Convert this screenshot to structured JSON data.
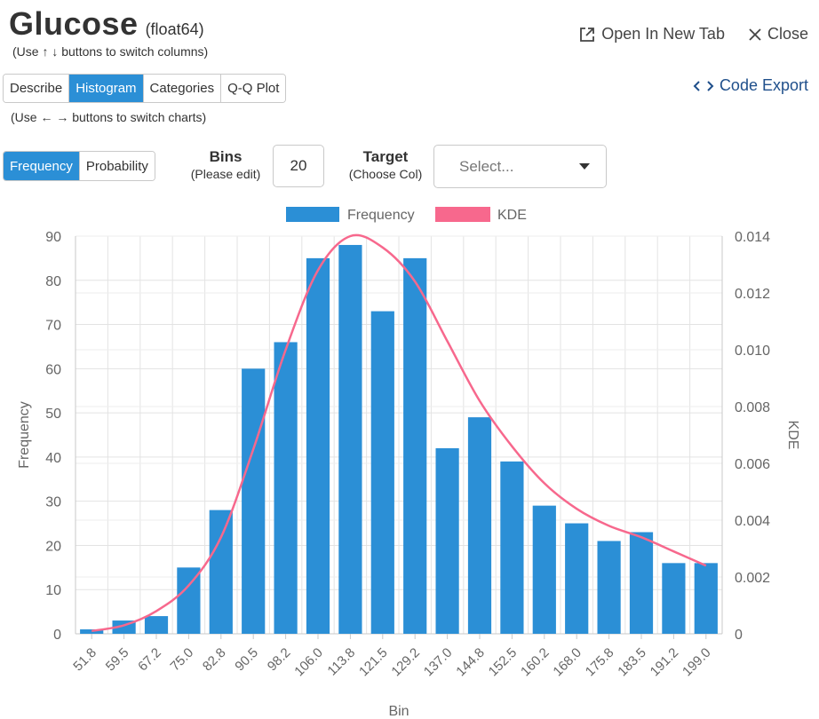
{
  "header": {
    "title": "Glucose",
    "dtype": "(float64)",
    "hint_columns": "(Use ↑ ↓ buttons to switch columns)",
    "hint_charts": "(Use ← → buttons to switch charts)",
    "open_new_tab": "Open In New Tab",
    "close": "Close",
    "code_export": "Code Export"
  },
  "chart_tabs": [
    "Describe",
    "Histogram",
    "Categories",
    "Q-Q Plot"
  ],
  "chart_tabs_active": "Histogram",
  "mode_tabs": [
    "Frequency",
    "Probability"
  ],
  "mode_tabs_active": "Frequency",
  "controls": {
    "bins_label": "Bins",
    "bins_sub": "(Please edit)",
    "bins_value": "20",
    "target_label": "Target",
    "target_sub": "(Choose Col)",
    "target_placeholder": "Select..."
  },
  "colors": {
    "accent": "#2b8fd6",
    "bar": "#2b8fd6",
    "kde": "#f7688d"
  },
  "chart_data": {
    "type": "bar",
    "categories": [
      "51.8",
      "59.5",
      "67.2",
      "75.0",
      "82.8",
      "90.5",
      "98.2",
      "106.0",
      "113.8",
      "121.5",
      "129.2",
      "137.0",
      "144.8",
      "152.5",
      "160.2",
      "168.0",
      "175.8",
      "183.5",
      "191.2",
      "199.0"
    ],
    "series": [
      {
        "name": "Frequency",
        "type": "bar",
        "axis": "left",
        "values": [
          1,
          3,
          4,
          15,
          28,
          60,
          66,
          85,
          88,
          73,
          85,
          42,
          49,
          39,
          29,
          25,
          21,
          23,
          16,
          16
        ]
      },
      {
        "name": "KDE",
        "type": "line",
        "axis": "right",
        "values": [
          0.0001,
          0.0003,
          0.0008,
          0.0017,
          0.0034,
          0.0065,
          0.01,
          0.0128,
          0.014,
          0.0136,
          0.0124,
          0.0103,
          0.0082,
          0.0066,
          0.0053,
          0.0044,
          0.0038,
          0.0034,
          0.0029,
          0.0024
        ]
      }
    ],
    "xlabel": "Bin",
    "ylabel": "Frequency",
    "y2label": "KDE",
    "ylim": [
      0,
      90
    ],
    "y2lim": [
      0,
      0.014
    ],
    "yticks": [
      "0",
      "10",
      "20",
      "30",
      "40",
      "50",
      "60",
      "70",
      "80",
      "90"
    ],
    "y2ticks": [
      "0",
      "0.002",
      "0.004",
      "0.006",
      "0.008",
      "0.010",
      "0.012",
      "0.014"
    ],
    "grid": true,
    "legend": "top-center"
  }
}
